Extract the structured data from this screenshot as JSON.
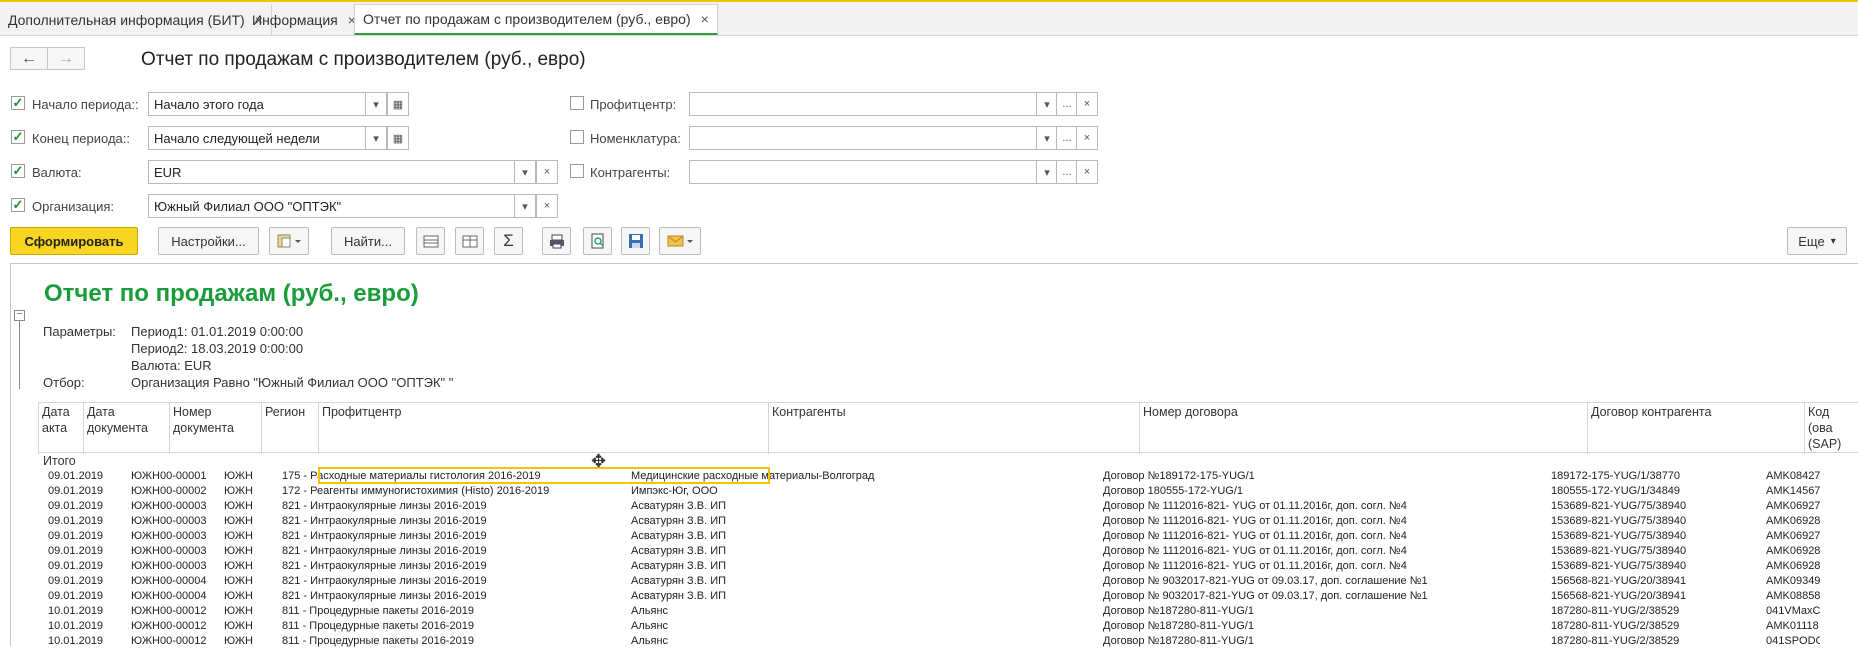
{
  "tabs": [
    {
      "label": "Дополнительная информация (БИТ)",
      "close": "×"
    },
    {
      "label": "Информация",
      "close": "×"
    },
    {
      "label": "Отчет по продажам с производителем (руб., евро)",
      "close": "×"
    }
  ],
  "nav": {
    "back": "←",
    "forward": "→",
    "title": "Отчет по продажам с производителем (руб., евро)"
  },
  "filters": {
    "left": [
      {
        "label": "Начало периода::",
        "value": "Начало этого года",
        "checked": true
      },
      {
        "label": "Конец периода::",
        "value": "Начало следующей недели",
        "checked": true
      },
      {
        "label": "Валюта:",
        "value": "EUR",
        "checked": true
      },
      {
        "label": "Организация:",
        "value": "Южный Филиал  ООО \"ОПТЭК\"",
        "checked": true
      }
    ],
    "right": [
      {
        "label": "Профитцентр:",
        "value": "",
        "checked": false
      },
      {
        "label": "Номенклатура:",
        "value": "",
        "checked": false
      },
      {
        "label": "Контрагенты:",
        "value": "",
        "checked": false
      }
    ],
    "check_mark": "✓",
    "dropdown": "▾",
    "calendar": "▦",
    "clear": "×",
    "more": "..."
  },
  "toolbar": {
    "generate": "Сформировать",
    "settings": "Настройки...",
    "find": "Найти...",
    "more": "Еще",
    "sum": "Σ"
  },
  "report": {
    "title": "Отчет по продажам (руб., евро)",
    "params_label": "Параметры:",
    "period1": "Период1: 01.01.2019 0:00:00",
    "period2": "Период2: 18.03.2019 0:00:00",
    "currency": "Валюта: EUR",
    "filter_label": "Отбор:",
    "filter_value": "Организация Равно \"Южный Филиал  ООО \"ОПТЭК\" \"",
    "group_toggle": "−",
    "total_label": "Итого",
    "columns": [
      "Дата акта",
      "Дата документа",
      "Номер документа",
      "Регион",
      "Профитцентр",
      "Контрагенты",
      "Номер договора",
      "Договор контрагента",
      "Код (ова (SAP)"
    ],
    "rows": [
      [
        "09.01.2019",
        "ЮЖН00-00001",
        "ЮЖН",
        "175 - Расходные материалы гистология 2016-2019",
        "Медицинские расходные материалы-Волгоград",
        "Договор №189172-175-YUG/1",
        "189172-175-YUG/1/38770",
        "AMK08427"
      ],
      [
        "09.01.2019",
        "ЮЖН00-00002",
        "ЮЖН",
        "172 - Реагенты иммуногистохимия (Histo) 2016-2019",
        "Импэкс-Юг, ООО",
        "Договор 180555-172-YUG/1",
        "180555-172-YUG/1/34849",
        "AMK14567"
      ],
      [
        "09.01.2019",
        "ЮЖН00-00003",
        "ЮЖН",
        "821 - Интраокулярные линзы 2016-2019",
        "Асватурян З.В. ИП",
        "Договор № 1112016-821- YUG от 01.11.2016г, доп. согл. №4",
        "153689-821-YUG/75/38940",
        "AMK06927"
      ],
      [
        "09.01.2019",
        "ЮЖН00-00003",
        "ЮЖН",
        "821 - Интраокулярные линзы 2016-2019",
        "Асватурян З.В. ИП",
        "Договор № 1112016-821- YUG от 01.11.2016г, доп. согл. №4",
        "153689-821-YUG/75/38940",
        "AMK06928"
      ],
      [
        "09.01.2019",
        "ЮЖН00-00003",
        "ЮЖН",
        "821 - Интраокулярные линзы 2016-2019",
        "Асватурян З.В. ИП",
        "Договор № 1112016-821- YUG от 01.11.2016г, доп. согл. №4",
        "153689-821-YUG/75/38940",
        "AMK06927"
      ],
      [
        "09.01.2019",
        "ЮЖН00-00003",
        "ЮЖН",
        "821 - Интраокулярные линзы 2016-2019",
        "Асватурян З.В. ИП",
        "Договор № 1112016-821- YUG от 01.11.2016г, доп. согл. №4",
        "153689-821-YUG/75/38940",
        "AMK06928"
      ],
      [
        "09.01.2019",
        "ЮЖН00-00003",
        "ЮЖН",
        "821 - Интраокулярные линзы 2016-2019",
        "Асватурян З.В. ИП",
        "Договор № 1112016-821- YUG от 01.11.2016г, доп. согл. №4",
        "153689-821-YUG/75/38940",
        "AMK06928"
      ],
      [
        "09.01.2019",
        "ЮЖН00-00004",
        "ЮЖН",
        "821 - Интраокулярные линзы 2016-2019",
        "Асватурян З.В. ИП",
        "Договор № 9032017-821-YUG от 09.03.17, доп. соглашение №1",
        "156568-821-YUG/20/38941",
        "AMK09349"
      ],
      [
        "09.01.2019",
        "ЮЖН00-00004",
        "ЮЖН",
        "821 - Интраокулярные линзы 2016-2019",
        "Асватурян З.В. ИП",
        "Договор № 9032017-821-YUG от 09.03.17, доп. соглашение №1",
        "156568-821-YUG/20/38941",
        "AMK08858"
      ],
      [
        "10.01.2019",
        "ЮЖН00-00012",
        "ЮЖН",
        "811 - Процедурные пакеты 2016-2019",
        "Альянс",
        "Договор №187280-811-YUG/1",
        "187280-811-YUG/2/38529",
        "041VMaxC"
      ],
      [
        "10.01.2019",
        "ЮЖН00-00012",
        "ЮЖН",
        "811 - Процедурные пакеты 2016-2019",
        "Альянс",
        "Договор №187280-811-YUG/1",
        "187280-811-YUG/2/38529",
        "AMK01118"
      ],
      [
        "10.01.2019",
        "ЮЖН00-00012",
        "ЮЖН",
        "811 - Процедурные пакеты 2016-2019",
        "Альянс",
        "Договор №187280-811-YUG/1",
        "187280-811-YUG/2/38529",
        "041SPODC"
      ]
    ]
  }
}
